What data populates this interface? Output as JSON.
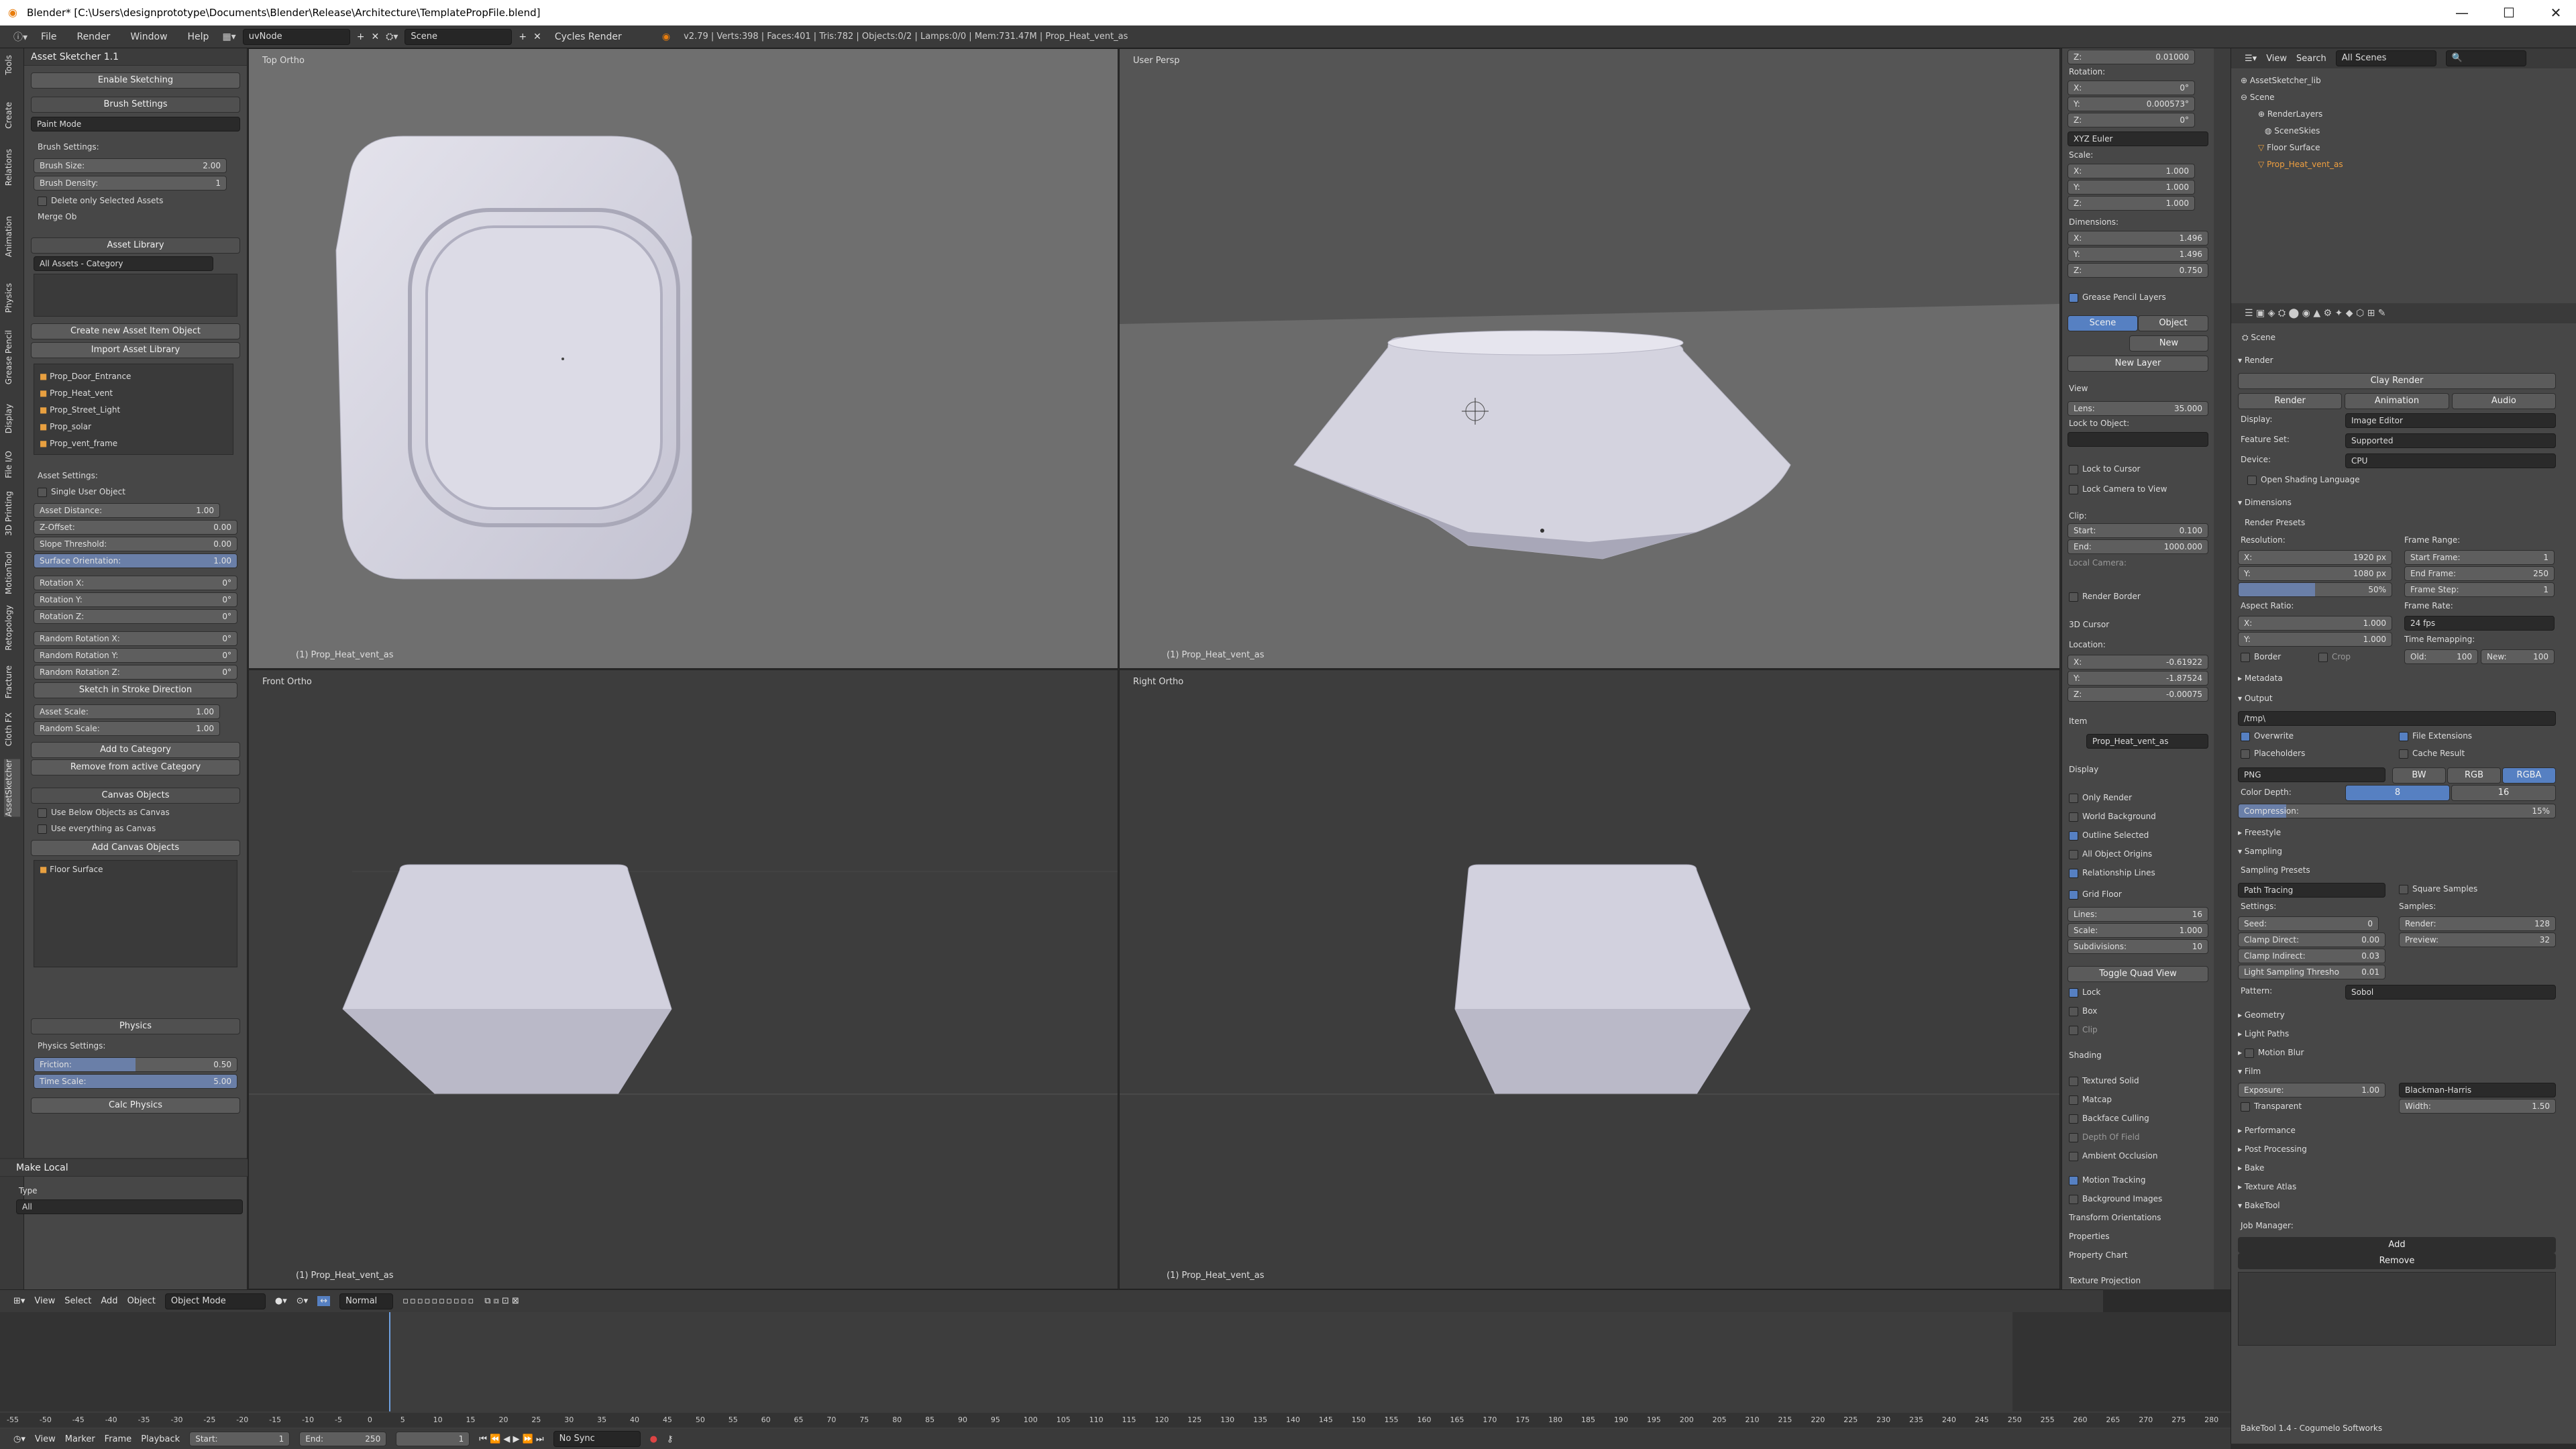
{
  "window": {
    "title": "Blender* [C:\\Users\\designprototype\\Documents\\Blender\\Release\\Architecture\\TemplatePropFile.blend]",
    "min": "—",
    "max": "☐",
    "close": "✕"
  },
  "menu": {
    "items": [
      "File",
      "Render",
      "Window",
      "Help"
    ],
    "layout": "uvNode",
    "scene": "Scene",
    "engine": "Cycles Render",
    "stats": "v2.79 | Verts:398 | Faces:401 | Tris:782 | Objects:0/2 | Lamps:0/0 | Mem:731.47M | Prop_Heat_vent_as"
  },
  "lefttabs": [
    "Tools",
    "Create",
    "Relations",
    "Animation",
    "Physics",
    "Grease Pencil",
    "Display",
    "File I/O",
    "3D Printing",
    "MotionTool",
    "Retopology",
    "Fracture",
    "Cloth FX",
    "AssetSketcher"
  ],
  "tool": {
    "title": "Asset Sketcher 1.1",
    "enable": "Enable Sketching",
    "brush_settings": "Brush Settings",
    "paint_mode": "Paint Mode",
    "brush_settings2": "Brush Settings:",
    "brush_size_label": "Brush Size:",
    "brush_size": "2.00",
    "brush_density_label": "Brush Density:",
    "brush_density": "1",
    "delete_only": "Delete only Selected Assets",
    "merge_ob": "Merge Ob",
    "asset_library": "Asset Library",
    "all_assets": "All Assets - Category",
    "create_new": "Create new Asset Item Object",
    "import_lib": "Import Asset Library",
    "assets": [
      "Prop_Door_Entrance",
      "Prop_Heat_vent",
      "Prop_Street_Light",
      "Prop_solar",
      "Prop_vent_frame"
    ],
    "asset_settings": "Asset Settings:",
    "single_user": "Single User Object",
    "fields": [
      {
        "l": "Asset Distance:",
        "v": "1.00"
      },
      {
        "l": "Z-Offset:",
        "v": "0.00"
      },
      {
        "l": "Slope Threshold:",
        "v": "0.00"
      },
      {
        "l": "Surface Orientation:",
        "v": "1.00"
      }
    ],
    "rot": [
      {
        "l": "Rotation X:",
        "v": "0°"
      },
      {
        "l": "Rotation Y:",
        "v": "0°"
      },
      {
        "l": "Rotation Z:",
        "v": "0°"
      }
    ],
    "rrot": [
      {
        "l": "Random Rotation X:",
        "v": "0°"
      },
      {
        "l": "Random Rotation Y:",
        "v": "0°"
      },
      {
        "l": "Random Rotation Z:",
        "v": "0°"
      }
    ],
    "sketch_stroke": "Sketch in Stroke Direction",
    "scale": [
      {
        "l": "Asset Scale:",
        "v": "1.00"
      },
      {
        "l": "Random Scale:",
        "v": "1.00"
      }
    ],
    "add_cat": "Add to Category",
    "remove_cat": "Remove from active Category",
    "canvas": "Canvas Objects",
    "use_below": "Use Below Objects as Canvas",
    "use_every": "Use everything as Canvas",
    "add_canvas": "Add Canvas Objects",
    "floor": "Floor Surface",
    "physics": "Physics",
    "physics_settings": "Physics Settings:",
    "friction_l": "Friction:",
    "friction": "0.50",
    "timescale_l": "Time Scale:",
    "timescale": "5.00",
    "calc": "Calc Physics",
    "make_local": "Make Local",
    "type_l": "Type",
    "type": "All"
  },
  "viewports": {
    "top": "Top Ortho",
    "persp": "User Persp",
    "front": "Front Ortho",
    "right": "Right Ortho",
    "obj": "(1) Prop_Heat_vent_as"
  },
  "npanel": {
    "z_top": "0.01000",
    "rotation": "Rotation:",
    "rx": "0°",
    "ry": "0.000573°",
    "rz": "0°",
    "euler": "XYZ Euler",
    "scale": "Scale:",
    "sx": "1.000",
    "sy": "1.000",
    "sz": "1.000",
    "dims": "Dimensions:",
    "dx": "1.496",
    "dy": "1.496",
    "dz": "0.750",
    "gp": "Grease Pencil Layers",
    "scene": "Scene",
    "object": "Object",
    "new": "New",
    "newlayer": "New Layer",
    "view": "View",
    "lens_l": "Lens:",
    "lens": "35.000",
    "lockobj": "Lock to Object:",
    "lockcursor": "Lock to Cursor",
    "lockcam": "Lock Camera to View",
    "clip": "Clip:",
    "start_l": "Start:",
    "start": "0.100",
    "end_l": "End:",
    "end": "1000.000",
    "localcam": "Local Camera:",
    "renderborder": "Render Border",
    "cursor": "3D Cursor",
    "location": "Location:",
    "cx": "-0.61922",
    "cy": "-1.87524",
    "cz": "-0.00075",
    "item": "Item",
    "itemname": "Prop_Heat_vent_as",
    "display": "Display",
    "onlyrender": "Only Render",
    "worldbg": "World Background",
    "outline": "Outline Selected",
    "allorigins": "All Object Origins",
    "rellines": "Relationship Lines",
    "gridfloor": "Grid Floor",
    "lines_l": "Lines:",
    "lines": "16",
    "gscale_l": "Scale:",
    "gscale": "1.000",
    "subdiv_l": "Subdivisions:",
    "subdiv": "10",
    "togglequad": "Toggle Quad View",
    "lock": "Lock",
    "box": "Box",
    "clipc": "Clip",
    "shading": "Shading",
    "textured": "Textured Solid",
    "matcap": "Matcap",
    "backface": "Backface Culling",
    "dof": "Depth Of Field",
    "ao": "Ambient Occlusion",
    "motion": "Motion Tracking",
    "bgimages": "Background Images",
    "transorient": "Transform Orientations",
    "properties": "Properties",
    "propchart": "Property Chart",
    "texproj": "Texture Projection"
  },
  "outliner": {
    "view": "View",
    "search": "Search",
    "allscenes": "All Scenes",
    "items": [
      "AssetSketcher_lib",
      "Scene",
      "RenderLayers",
      "SceneSkies",
      "Floor Surface",
      "Prop_Heat_vent_as"
    ]
  },
  "props": {
    "scene": "Scene",
    "render": "Render",
    "clayrender": "Clay Render",
    "btn_render": "Render",
    "btn_anim": "Animation",
    "btn_audio": "Audio",
    "display_l": "Display:",
    "display": "Image Editor",
    "feature_l": "Feature Set:",
    "feature": "Supported",
    "device_l": "Device:",
    "device": "CPU",
    "osl": "Open Shading Language",
    "dimensions": "Dimensions",
    "renderpresets": "Render Presets",
    "resolution": "Resolution:",
    "resx": "1920 px",
    "resy": "1080 px",
    "respct": "50%",
    "framerange": "Frame Range:",
    "sf_l": "Start Frame:",
    "sf": "1",
    "ef_l": "End Frame:",
    "ef": "250",
    "fs_l": "Frame Step:",
    "fs": "1",
    "aspect": "Aspect Ratio:",
    "ax": "1.000",
    "ay": "1.000",
    "framerate": "Frame Rate:",
    "fps": "24 fps",
    "timeremap": "Time Remapping:",
    "old": "Old:",
    "oldv": "100",
    "newr": "New:",
    "newv": "100",
    "border": "Border",
    "crop": "Crop",
    "metadata": "Metadata",
    "output": "Output",
    "outpath": "/tmp\\",
    "overwrite": "Overwrite",
    "fileext": "File Extensions",
    "placeholders": "Placeholders",
    "cache": "Cache Result",
    "format": "PNG",
    "bw": "BW",
    "rgb": "RGB",
    "rgba": "RGBA",
    "colordepth": "Color Depth:",
    "cd8": "8",
    "cd16": "16",
    "compression": "Compression:",
    "compv": "15%",
    "freestyle": "Freestyle",
    "sampling": "Sampling",
    "samplingpresets": "Sampling Presets",
    "pathtracing": "Path Tracing",
    "squaresamples": "Square Samples",
    "settings": "Settings:",
    "samples": "Samples:",
    "seed_l": "Seed:",
    "seed": "0",
    "render_l": "Render:",
    "renderv": "128",
    "cd_l": "Clamp Direct:",
    "cd": "0.00",
    "preview_l": "Preview:",
    "previewv": "32",
    "ci_l": "Clamp Indirect:",
    "ci": "0.03",
    "lst_l": "Light Sampling Thresho",
    "lst": "0.01",
    "pattern_l": "Pattern:",
    "pattern": "Sobol",
    "geometry": "Geometry",
    "lightpaths": "Light Paths",
    "motionblur": "Motion Blur",
    "film": "Film",
    "exposure_l": "Exposure:",
    "exposure": "1.00",
    "filter": "Blackman-Harris",
    "transparent": "Transparent",
    "width_l": "Width:",
    "width": "1.50",
    "performance": "Performance",
    "postproc": "Post Processing",
    "bake": "Bake",
    "texatlas": "Texture Atlas",
    "baketool": "BakeTool",
    "jobmanager": "Job Manager:",
    "add": "Add",
    "remove": "Remove",
    "footer": "BakeTool 1.4 - Cogumelo Softworks"
  },
  "vtb": {
    "view": "View",
    "select": "Select",
    "add": "Add",
    "object": "Object",
    "mode": "Object Mode",
    "normal": "Normal"
  },
  "timeline": {
    "ticks": [
      "-55",
      "-50",
      "-45",
      "-40",
      "-35",
      "-30",
      "-25",
      "-20",
      "-15",
      "-10",
      "-5",
      "0",
      "5",
      "10",
      "15",
      "20",
      "25",
      "30",
      "35",
      "40",
      "45",
      "50",
      "55",
      "60",
      "65",
      "70",
      "75",
      "80",
      "85",
      "90",
      "95",
      "100",
      "105",
      "110",
      "115",
      "120",
      "125",
      "130",
      "135",
      "140",
      "145",
      "150",
      "155",
      "160",
      "165",
      "170",
      "175",
      "180",
      "185",
      "190",
      "195",
      "200",
      "205",
      "210",
      "215",
      "220",
      "225",
      "230",
      "235",
      "240",
      "245",
      "250",
      "255",
      "260",
      "265",
      "270",
      "275",
      "280"
    ],
    "view": "View",
    "marker": "Marker",
    "frame": "Frame",
    "playback": "Playback",
    "start_l": "Start:",
    "start": "1",
    "end_l": "End:",
    "end": "250",
    "cur": "1",
    "sync": "No Sync"
  }
}
